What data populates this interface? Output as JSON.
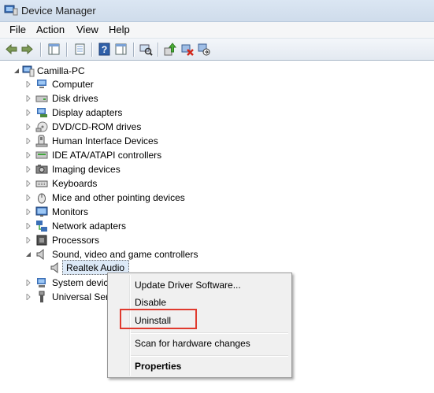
{
  "window": {
    "title": "Device Manager",
    "icon": "device-manager-icon"
  },
  "menu": {
    "file": "File",
    "action": "Action",
    "view": "View",
    "help": "Help"
  },
  "toolbar": {
    "buttons": [
      "back-arrow-icon",
      "forward-arrow-icon",
      "show-hide-console-tree-icon",
      "properties-icon",
      "help-icon",
      "action-pane-icon",
      "scan-hardware-icon",
      "update-driver-icon",
      "uninstall-icon",
      "disable-device-icon"
    ]
  },
  "tree": {
    "root": "Camilla-PC",
    "categories": [
      {
        "label": "Computer",
        "icon": "computer-icon"
      },
      {
        "label": "Disk drives",
        "icon": "disk-drive-icon"
      },
      {
        "label": "Display adapters",
        "icon": "display-adapter-icon"
      },
      {
        "label": "DVD/CD-ROM drives",
        "icon": "dvd-drive-icon"
      },
      {
        "label": "Human Interface Devices",
        "icon": "hid-icon"
      },
      {
        "label": "IDE ATA/ATAPI controllers",
        "icon": "ide-controller-icon"
      },
      {
        "label": "Imaging devices",
        "icon": "camera-icon"
      },
      {
        "label": "Keyboards",
        "icon": "keyboard-icon"
      },
      {
        "label": "Mice and other pointing devices",
        "icon": "mouse-icon"
      },
      {
        "label": "Monitors",
        "icon": "monitor-icon"
      },
      {
        "label": "Network adapters",
        "icon": "network-icon"
      },
      {
        "label": "Processors",
        "icon": "processor-icon"
      },
      {
        "label": "Sound, video and game controllers",
        "icon": "speaker-icon"
      }
    ],
    "child": {
      "label": "Realtek Audio",
      "icon": "speaker-icon",
      "selected": true
    },
    "after": [
      {
        "label": "System devic",
        "icon": "system-icon"
      },
      {
        "label": "Universal Seri",
        "icon": "usb-icon"
      }
    ]
  },
  "context_menu": {
    "update_driver": "Update Driver Software...",
    "disable": "Disable",
    "uninstall": "Uninstall",
    "scan": "Scan for hardware changes",
    "properties": "Properties"
  },
  "colors": {
    "highlight": "#e03a2e",
    "selection": "#dce9f7"
  }
}
